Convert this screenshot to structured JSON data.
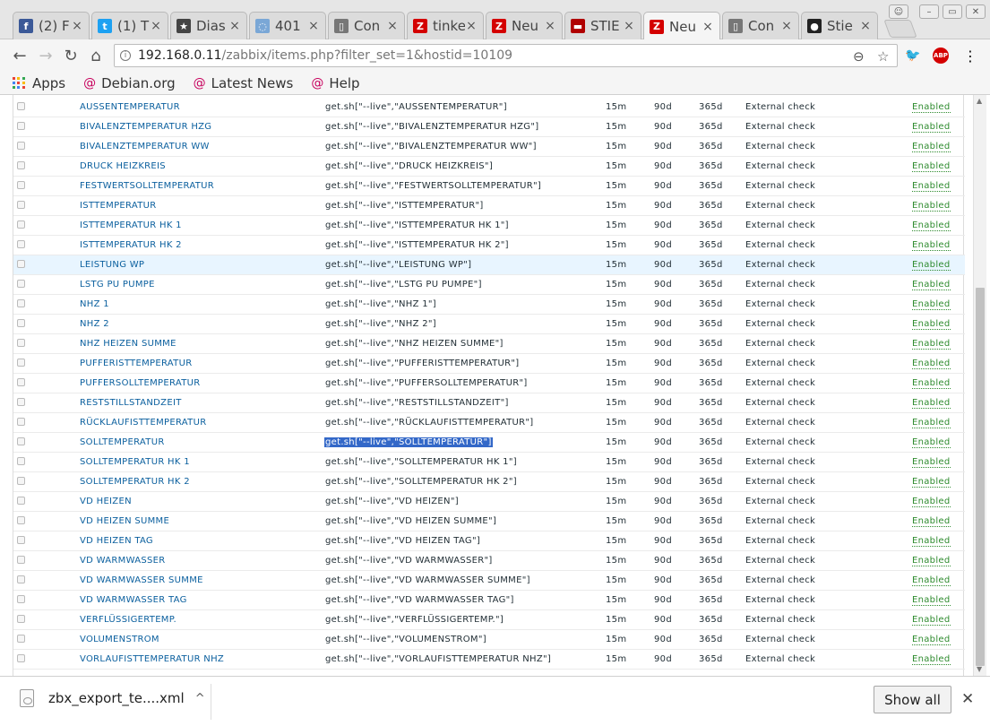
{
  "tabs": [
    {
      "title": "(2) F",
      "icon": "facebook-icon",
      "color": "#3b5998",
      "glyph": "f"
    },
    {
      "title": "(1) T",
      "icon": "twitter-icon",
      "color": "#1da1f2",
      "glyph": "t"
    },
    {
      "title": "Dias",
      "icon": "star-badge-icon",
      "color": "#444444",
      "glyph": "★"
    },
    {
      "title": "401",
      "icon": "loading-spinner-icon",
      "color": "#7aa7d6",
      "glyph": "◌"
    },
    {
      "title": "Con",
      "icon": "page-icon",
      "color": "#777777",
      "glyph": "▯"
    },
    {
      "title": "tinke",
      "icon": "zabbix-icon",
      "color": "#d40000",
      "glyph": "Z"
    },
    {
      "title": "Neu",
      "icon": "zabbix-icon",
      "color": "#d40000",
      "glyph": "Z"
    },
    {
      "title": "STIE",
      "icon": "stiebel-icon",
      "color": "#b00000",
      "glyph": "▬"
    },
    {
      "title": "Neu",
      "icon": "zabbix-icon",
      "color": "#d40000",
      "glyph": "Z",
      "active": true
    },
    {
      "title": "Con",
      "icon": "page-icon",
      "color": "#777777",
      "glyph": "▯"
    },
    {
      "title": "Stie",
      "icon": "github-icon",
      "color": "#222222",
      "glyph": "●"
    }
  ],
  "toolbar": {
    "url_host": "192.168.0.11",
    "url_path": "/zabbix/items.php?filter_set=1&hostid=10109",
    "abp_label": "ABP"
  },
  "bookmarks": [
    {
      "label": "Apps",
      "icon": "apps-grid-icon"
    },
    {
      "label": "Debian.org",
      "icon": "debian-icon"
    },
    {
      "label": "Latest News",
      "icon": "debian-icon"
    },
    {
      "label": "Help",
      "icon": "debian-icon"
    }
  ],
  "items": [
    {
      "name": "AUSSENTEMPERATUR",
      "key": "get.sh[\"--live\",\"AUSSENTEMPERATUR\"]",
      "interval": "15m",
      "history": "90d",
      "trends": "365d",
      "type": "External check",
      "status": "Enabled"
    },
    {
      "name": "BIVALENZTEMPERATUR HZG",
      "key": "get.sh[\"--live\",\"BIVALENZTEMPERATUR HZG\"]",
      "interval": "15m",
      "history": "90d",
      "trends": "365d",
      "type": "External check",
      "status": "Enabled"
    },
    {
      "name": "BIVALENZTEMPERATUR WW",
      "key": "get.sh[\"--live\",\"BIVALENZTEMPERATUR WW\"]",
      "interval": "15m",
      "history": "90d",
      "trends": "365d",
      "type": "External check",
      "status": "Enabled"
    },
    {
      "name": "DRUCK HEIZKREIS",
      "key": "get.sh[\"--live\",\"DRUCK HEIZKREIS\"]",
      "interval": "15m",
      "history": "90d",
      "trends": "365d",
      "type": "External check",
      "status": "Enabled"
    },
    {
      "name": "FESTWERTSOLLTEMPERATUR",
      "key": "get.sh[\"--live\",\"FESTWERTSOLLTEMPERATUR\"]",
      "interval": "15m",
      "history": "90d",
      "trends": "365d",
      "type": "External check",
      "status": "Enabled"
    },
    {
      "name": "ISTTEMPERATUR",
      "key": "get.sh[\"--live\",\"ISTTEMPERATUR\"]",
      "interval": "15m",
      "history": "90d",
      "trends": "365d",
      "type": "External check",
      "status": "Enabled"
    },
    {
      "name": "ISTTEMPERATUR HK 1",
      "key": "get.sh[\"--live\",\"ISTTEMPERATUR HK 1\"]",
      "interval": "15m",
      "history": "90d",
      "trends": "365d",
      "type": "External check",
      "status": "Enabled"
    },
    {
      "name": "ISTTEMPERATUR HK 2",
      "key": "get.sh[\"--live\",\"ISTTEMPERATUR HK 2\"]",
      "interval": "15m",
      "history": "90d",
      "trends": "365d",
      "type": "External check",
      "status": "Enabled"
    },
    {
      "name": "LEISTUNG WP",
      "key": "get.sh[\"--live\",\"LEISTUNG WP\"]",
      "interval": "15m",
      "history": "90d",
      "trends": "365d",
      "type": "External check",
      "status": "Enabled",
      "highlight": true
    },
    {
      "name": "LSTG PU PUMPE",
      "key": "get.sh[\"--live\",\"LSTG PU PUMPE\"]",
      "interval": "15m",
      "history": "90d",
      "trends": "365d",
      "type": "External check",
      "status": "Enabled"
    },
    {
      "name": "NHZ 1",
      "key": "get.sh[\"--live\",\"NHZ 1\"]",
      "interval": "15m",
      "history": "90d",
      "trends": "365d",
      "type": "External check",
      "status": "Enabled"
    },
    {
      "name": "NHZ 2",
      "key": "get.sh[\"--live\",\"NHZ 2\"]",
      "interval": "15m",
      "history": "90d",
      "trends": "365d",
      "type": "External check",
      "status": "Enabled"
    },
    {
      "name": "NHZ HEIZEN SUMME",
      "key": "get.sh[\"--live\",\"NHZ HEIZEN SUMME\"]",
      "interval": "15m",
      "history": "90d",
      "trends": "365d",
      "type": "External check",
      "status": "Enabled"
    },
    {
      "name": "PUFFERISTTEMPERATUR",
      "key": "get.sh[\"--live\",\"PUFFERISTTEMPERATUR\"]",
      "interval": "15m",
      "history": "90d",
      "trends": "365d",
      "type": "External check",
      "status": "Enabled"
    },
    {
      "name": "PUFFERSOLLTEMPERATUR",
      "key": "get.sh[\"--live\",\"PUFFERSOLLTEMPERATUR\"]",
      "interval": "15m",
      "history": "90d",
      "trends": "365d",
      "type": "External check",
      "status": "Enabled"
    },
    {
      "name": "RESTSTILLSTANDZEIT",
      "key": "get.sh[\"--live\",\"RESTSTILLSTANDZEIT\"]",
      "interval": "15m",
      "history": "90d",
      "trends": "365d",
      "type": "External check",
      "status": "Enabled"
    },
    {
      "name": "RÜCKLAUFISTTEMPERATUR",
      "key": "get.sh[\"--live\",\"RÜCKLAUFISTTEMPERATUR\"]",
      "interval": "15m",
      "history": "90d",
      "trends": "365d",
      "type": "External check",
      "status": "Enabled"
    },
    {
      "name": "SOLLTEMPERATUR",
      "key": "get.sh[\"--live\",\"SOLLTEMPERATUR\"]",
      "interval": "15m",
      "history": "90d",
      "trends": "365d",
      "type": "External check",
      "status": "Enabled",
      "key_selected": true
    },
    {
      "name": "SOLLTEMPERATUR HK 1",
      "key": "get.sh[\"--live\",\"SOLLTEMPERATUR HK 1\"]",
      "interval": "15m",
      "history": "90d",
      "trends": "365d",
      "type": "External check",
      "status": "Enabled"
    },
    {
      "name": "SOLLTEMPERATUR HK 2",
      "key": "get.sh[\"--live\",\"SOLLTEMPERATUR HK 2\"]",
      "interval": "15m",
      "history": "90d",
      "trends": "365d",
      "type": "External check",
      "status": "Enabled"
    },
    {
      "name": "VD HEIZEN",
      "key": "get.sh[\"--live\",\"VD HEIZEN\"]",
      "interval": "15m",
      "history": "90d",
      "trends": "365d",
      "type": "External check",
      "status": "Enabled"
    },
    {
      "name": "VD HEIZEN SUMME",
      "key": "get.sh[\"--live\",\"VD HEIZEN SUMME\"]",
      "interval": "15m",
      "history": "90d",
      "trends": "365d",
      "type": "External check",
      "status": "Enabled"
    },
    {
      "name": "VD HEIZEN TAG",
      "key": "get.sh[\"--live\",\"VD HEIZEN TAG\"]",
      "interval": "15m",
      "history": "90d",
      "trends": "365d",
      "type": "External check",
      "status": "Enabled"
    },
    {
      "name": "VD WARMWASSER",
      "key": "get.sh[\"--live\",\"VD WARMWASSER\"]",
      "interval": "15m",
      "history": "90d",
      "trends": "365d",
      "type": "External check",
      "status": "Enabled"
    },
    {
      "name": "VD WARMWASSER SUMME",
      "key": "get.sh[\"--live\",\"VD WARMWASSER SUMME\"]",
      "interval": "15m",
      "history": "90d",
      "trends": "365d",
      "type": "External check",
      "status": "Enabled"
    },
    {
      "name": "VD WARMWASSER TAG",
      "key": "get.sh[\"--live\",\"VD WARMWASSER TAG\"]",
      "interval": "15m",
      "history": "90d",
      "trends": "365d",
      "type": "External check",
      "status": "Enabled"
    },
    {
      "name": "VERFLÜSSIGERTEMP.",
      "key": "get.sh[\"--live\",\"VERFLÜSSIGERTEMP.\"]",
      "interval": "15m",
      "history": "90d",
      "trends": "365d",
      "type": "External check",
      "status": "Enabled"
    },
    {
      "name": "VOLUMENSTROM",
      "key": "get.sh[\"--live\",\"VOLUMENSTROM\"]",
      "interval": "15m",
      "history": "90d",
      "trends": "365d",
      "type": "External check",
      "status": "Enabled"
    },
    {
      "name": "VORLAUFISTTEMPERATUR NHZ",
      "key": "get.sh[\"--live\",\"VORLAUFISTTEMPERATUR NHZ\"]",
      "interval": "15m",
      "history": "90d",
      "trends": "365d",
      "type": "External check",
      "status": "Enabled"
    }
  ],
  "download": {
    "filename": "zbx_export_te....xml",
    "show_all_label": "Show all"
  },
  "colors": {
    "link": "#0a5f9e",
    "enabled": "#2e8b2e",
    "selection": "#3368c8",
    "row_highlight": "#e8f5ff"
  }
}
